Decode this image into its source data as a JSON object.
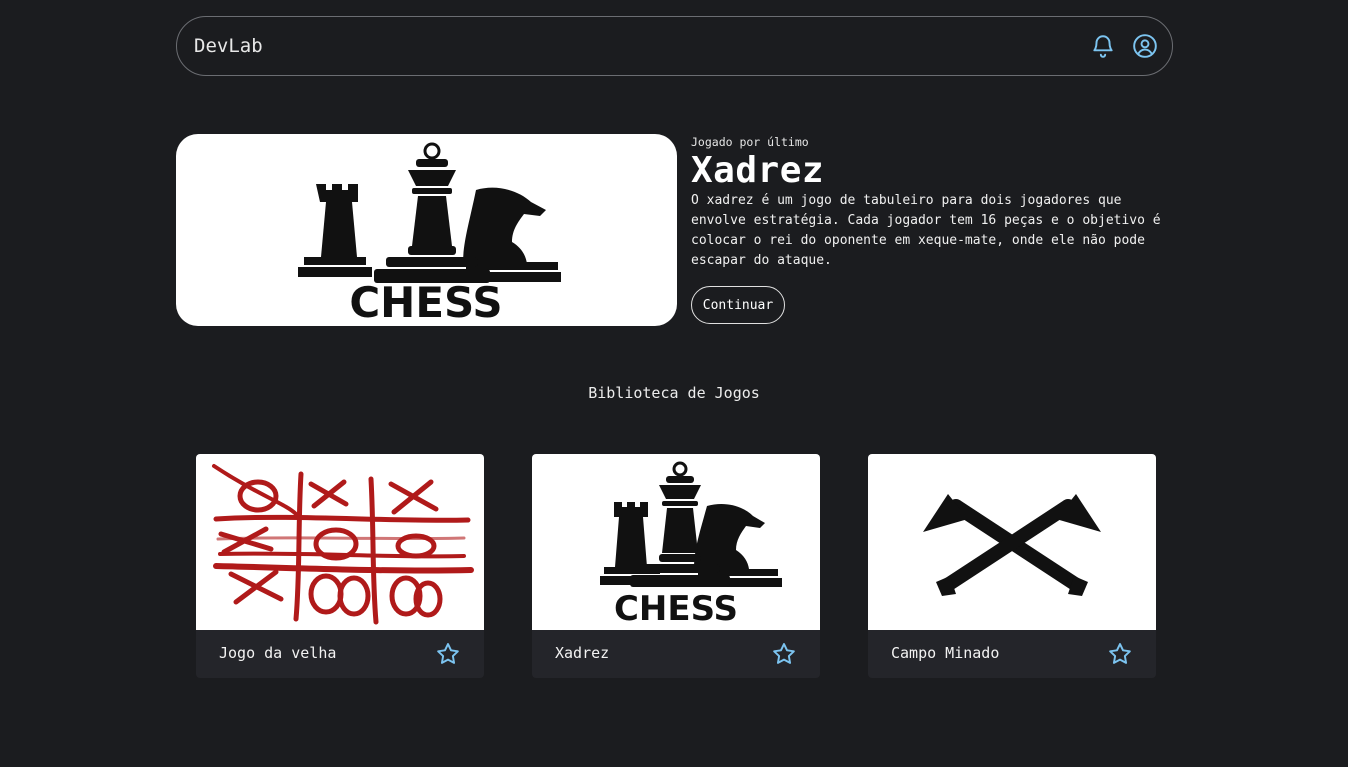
{
  "header": {
    "brand": "DevLab",
    "icons": [
      "bell-icon",
      "user-circle-icon"
    ]
  },
  "hero": {
    "label": "Jogado por último",
    "title": "Xadrez",
    "description": "O xadrez é um jogo de tabuleiro para dois jogadores que envolve estratégia. Cada jogador tem 16 peças e o objetivo é colocar o rei do oponente em xeque-mate, onde ele não pode escapar do ataque.",
    "button": "Continuar",
    "image_text": "CHESS"
  },
  "library": {
    "title": "Biblioteca de Jogos",
    "games": [
      {
        "title": "Jogo da velha",
        "icon": "star-icon"
      },
      {
        "title": "Xadrez",
        "icon": "star-icon",
        "image_text": "CHESS"
      },
      {
        "title": "Campo Minado",
        "icon": "star-icon"
      }
    ]
  },
  "colors": {
    "background": "#1b1c1f",
    "card": "#24252a",
    "accent": "#7cc4f0",
    "tic_tac_toe_red": "#b01a1a"
  }
}
